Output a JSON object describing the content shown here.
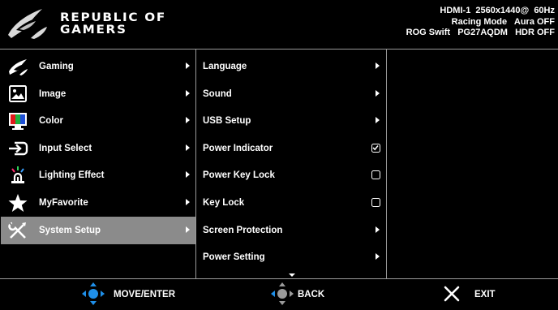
{
  "brand": {
    "line1": "REPUBLIC OF",
    "line2": "GAMERS"
  },
  "status": {
    "row1": "HDMI-1  2560x1440@  60Hz",
    "row2": "Racing Mode   Aura OFF",
    "row3": "ROG Swift   PG27AQDM   HDR OFF"
  },
  "main_menu": [
    {
      "label": "Gaming",
      "icon": "rog-eye-icon"
    },
    {
      "label": "Image",
      "icon": "image-icon"
    },
    {
      "label": "Color",
      "icon": "color-icon"
    },
    {
      "label": "Input Select",
      "icon": "input-select-icon"
    },
    {
      "label": "Lighting Effect",
      "icon": "lighting-effect-icon"
    },
    {
      "label": "MyFavorite",
      "icon": "star-icon"
    },
    {
      "label": "System Setup",
      "icon": "wrench-screwdriver-icon",
      "selected": true
    }
  ],
  "sub_menu": [
    {
      "label": "Language",
      "control": "arrow"
    },
    {
      "label": "Sound",
      "control": "arrow"
    },
    {
      "label": "USB Setup",
      "control": "arrow"
    },
    {
      "label": "Power Indicator",
      "control": "checkbox",
      "checked": true
    },
    {
      "label": "Power Key Lock",
      "control": "checkbox",
      "checked": false
    },
    {
      "label": "Key Lock",
      "control": "checkbox",
      "checked": false
    },
    {
      "label": "Screen Protection",
      "control": "arrow"
    },
    {
      "label": "Power Setting",
      "control": "arrow"
    }
  ],
  "footer": {
    "move_enter": "MOVE/ENTER",
    "back": "BACK",
    "exit": "EXIT"
  },
  "colors": {
    "selected_row": "#8b8b8b",
    "joystick_blue": "#1f8fe8",
    "divider": "#9a9a9a"
  }
}
